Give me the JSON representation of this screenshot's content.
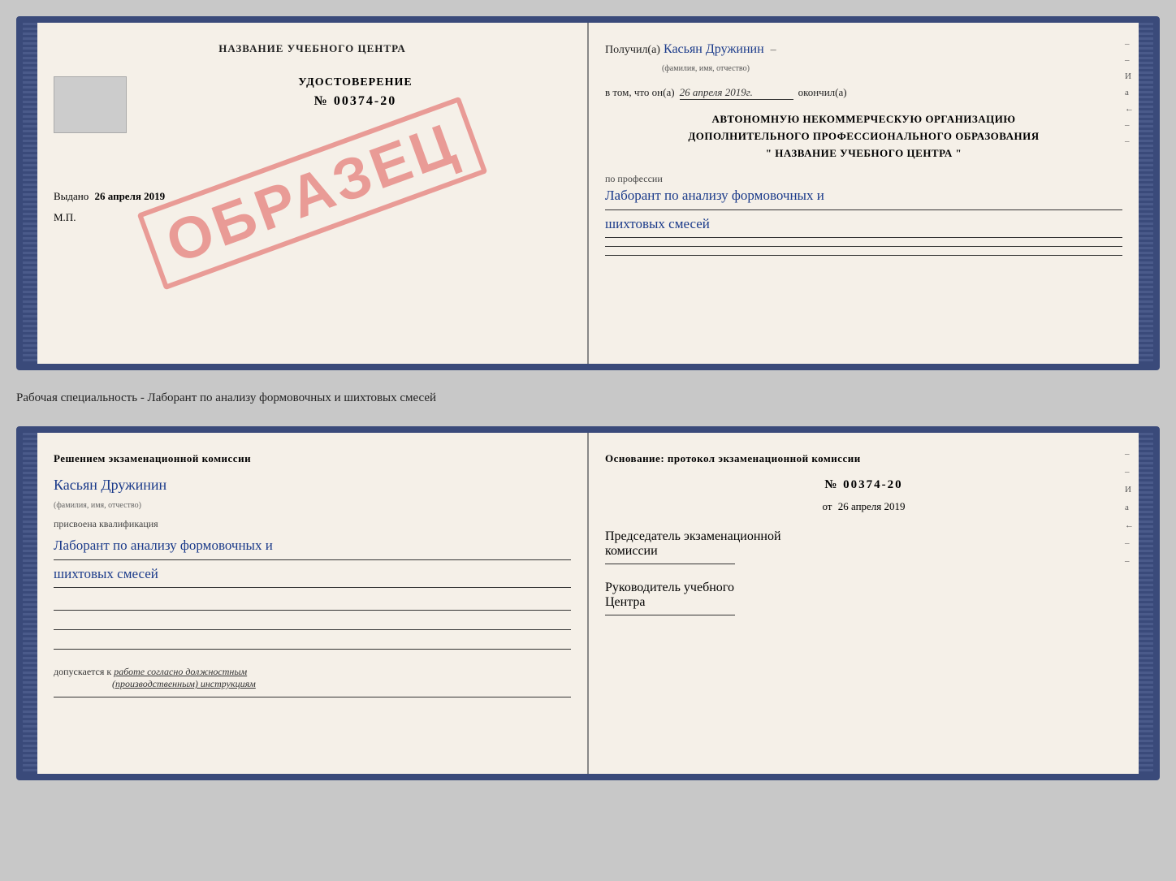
{
  "page": {
    "background": "#c8c8c8"
  },
  "top_cert": {
    "left": {
      "title": "НАЗВАНИЕ УЧЕБНОГО ЦЕНТРА",
      "udost_label": "УДОСТОВЕРЕНИЕ",
      "number": "№ 00374-20",
      "vydano_label": "Выдано",
      "vydano_date": "26 апреля 2019",
      "mp_label": "М.П.",
      "stamp_text": "ОБРАЗЕЦ"
    },
    "right": {
      "poluchil_label": "Получил(а)",
      "poluchil_name": "Касьян Дружинин",
      "fio_sub": "(фамилия, имя, отчество)",
      "vtom_label": "в том, что он(а)",
      "vtom_date": "26 апреля 2019г.",
      "okonchil_label": "окончил(а)",
      "avtonom_line1": "АВТОНОМНУЮ НЕКОММЕРЧЕСКУЮ ОРГАНИЗАЦИЮ",
      "avtonom_line2": "ДОПОЛНИТЕЛЬНОГО ПРОФЕССИОНАЛЬНОГО ОБРАЗОВАНИЯ",
      "avtonom_quote": "\" НАЗВАНИЕ УЧЕБНОГО ЦЕНТРА \"",
      "po_professii_label": "по профессии",
      "profession_handwritten": "Лаборант по анализу формовочных и",
      "profession_handwritten2": "шихтовых смесей",
      "right_markers": [
        "–",
        "–",
        "И",
        "а",
        "←",
        "–",
        "–"
      ]
    }
  },
  "specialty_label": "Рабочая специальность - Лаборант по анализу формовочных и шихтовых смесей",
  "bottom_cert": {
    "left": {
      "header": "Решением  экзаменационной  комиссии",
      "name_handwritten": "Касьян Дружинин",
      "fio_sub": "(фамилия, имя, отчество)",
      "kvali_label": "присвоена квалификация",
      "kvali_handwritten1": "Лаборант по анализу формовочных и",
      "kvali_handwritten2": "шихтовых смесей",
      "dopusk_label": "допускается к",
      "dopusk_italic": "работе согласно должностным",
      "dopusk_italic2": "(производственным) инструкциям"
    },
    "right": {
      "osnovanie_header": "Основание:  протокол  экзаменационной  комиссии",
      "protocol_number": "№  00374-20",
      "ot_label": "от",
      "ot_date": "26 апреля 2019",
      "predsedatel_label": "Председатель экзаменационной",
      "komisii_label": "комиссии",
      "rukovod_label": "Руководитель учебного",
      "tsentr_label": "Центра",
      "right_markers": [
        "–",
        "–",
        "И",
        "а",
        "←",
        "–",
        "–"
      ]
    }
  }
}
